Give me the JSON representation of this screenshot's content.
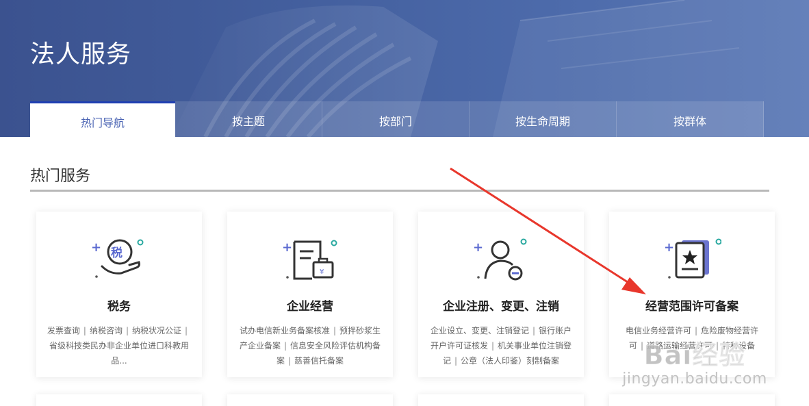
{
  "header": {
    "title": "法人服务",
    "tabs": [
      {
        "label": "热门导航",
        "active": true
      },
      {
        "label": "按主题"
      },
      {
        "label": "按部门"
      },
      {
        "label": "按生命周期"
      },
      {
        "label": "按群体"
      }
    ]
  },
  "section": {
    "title": "热门服务"
  },
  "cards": [
    {
      "title": "税务",
      "icon": "tax-hand-icon",
      "items": [
        "发票查询",
        "纳税咨询",
        "纳税状况公证",
        "省级科技类民办非企业单位进口科教用品..."
      ]
    },
    {
      "title": "企业经营",
      "icon": "document-briefcase-icon",
      "items": [
        "试办电信新业务备案核准",
        "预拌砂浆生产企业备案",
        "信息安全风险评估机构备案",
        "慈善信托备案"
      ]
    },
    {
      "title": "企业注册、变更、注销",
      "icon": "user-minus-icon",
      "items": [
        "企业设立、变更、注销登记",
        "银行账户开户许可证核发",
        "机关事业单位注销登记",
        "公章（法人印鉴）刻制备案"
      ]
    },
    {
      "title": "经营范围许可备案",
      "icon": "star-certificate-icon",
      "items": [
        "电信业务经营许可",
        "危险废物经营许可",
        "道路运输经营许可",
        "特种设备"
      ]
    }
  ],
  "watermark": {
    "main": "Bai经验",
    "sub": "jingyan.baidu.com"
  },
  "colors": {
    "banner": "#44609f",
    "accent": "#4a63b3",
    "tab_active_border": "#1f3fb2",
    "icon_plus": "#5b6ad0",
    "icon_dot": "#2aa9a0",
    "arrow": "#e8372c"
  }
}
